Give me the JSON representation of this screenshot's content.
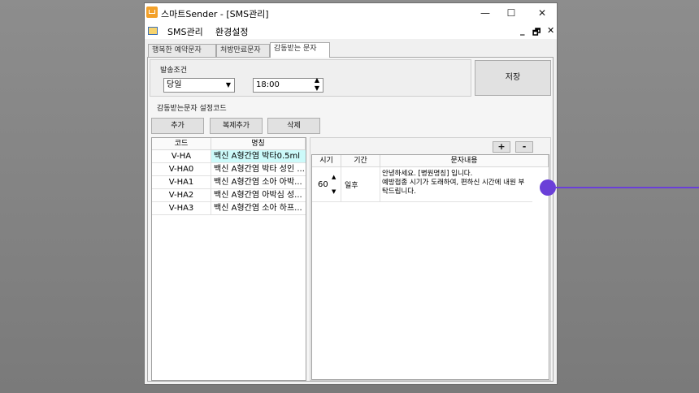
{
  "window": {
    "title": "스마트Sender - [SMS관리]",
    "controls": {
      "minimize": "—",
      "maximize": "☐",
      "close": "✕"
    }
  },
  "menu": {
    "items": [
      "SMS관리",
      "환경설정"
    ],
    "mdi_controls": [
      "_",
      "🗗",
      "✕"
    ]
  },
  "tabs": [
    {
      "label": "행복한 예약문자",
      "active": false
    },
    {
      "label": "처방만료문자",
      "active": false
    },
    {
      "label": "감동받는 문자",
      "active": true
    }
  ],
  "send_condition": {
    "label": "발송조건",
    "day_value": "당일",
    "time_value": "18:00"
  },
  "save_button": "저장",
  "code_settings": {
    "label": "감동받는문자 설정코드",
    "buttons": {
      "add": "추가",
      "copy_add": "복제추가",
      "delete": "삭제"
    }
  },
  "code_table": {
    "headers": {
      "code": "코드",
      "name": "명칭"
    },
    "rows": [
      {
        "code": "V-HA",
        "name": "백신 A형간염 박타0.5ml",
        "selected": true
      },
      {
        "code": "V-HA0",
        "name": "백신 A형간염 박타 성인 ...",
        "selected": false
      },
      {
        "code": "V-HA1",
        "name": "백신 A형간염 소아 아박...",
        "selected": false
      },
      {
        "code": "V-HA2",
        "name": "백신 A형간염 아박심 성...",
        "selected": false
      },
      {
        "code": "V-HA3",
        "name": "백신 A형간염 소아 하프...",
        "selected": false
      }
    ]
  },
  "message_table": {
    "plus_button": "+",
    "minus_button": "-",
    "headers": {
      "timing": "시기",
      "period": "기간",
      "content": "문자내용"
    },
    "rows": [
      {
        "timing": "60",
        "period": "일후",
        "content_lines": [
          "안녕하세요. [병원명칭] 입니다.",
          "예방접종 시기가 도래하여, 편하신 시간에 내원 부",
          "탁드립니다."
        ]
      }
    ]
  },
  "colors": {
    "selection": "#ccfafa",
    "pointer": "#6a3fd8",
    "desktop": "#808080"
  }
}
